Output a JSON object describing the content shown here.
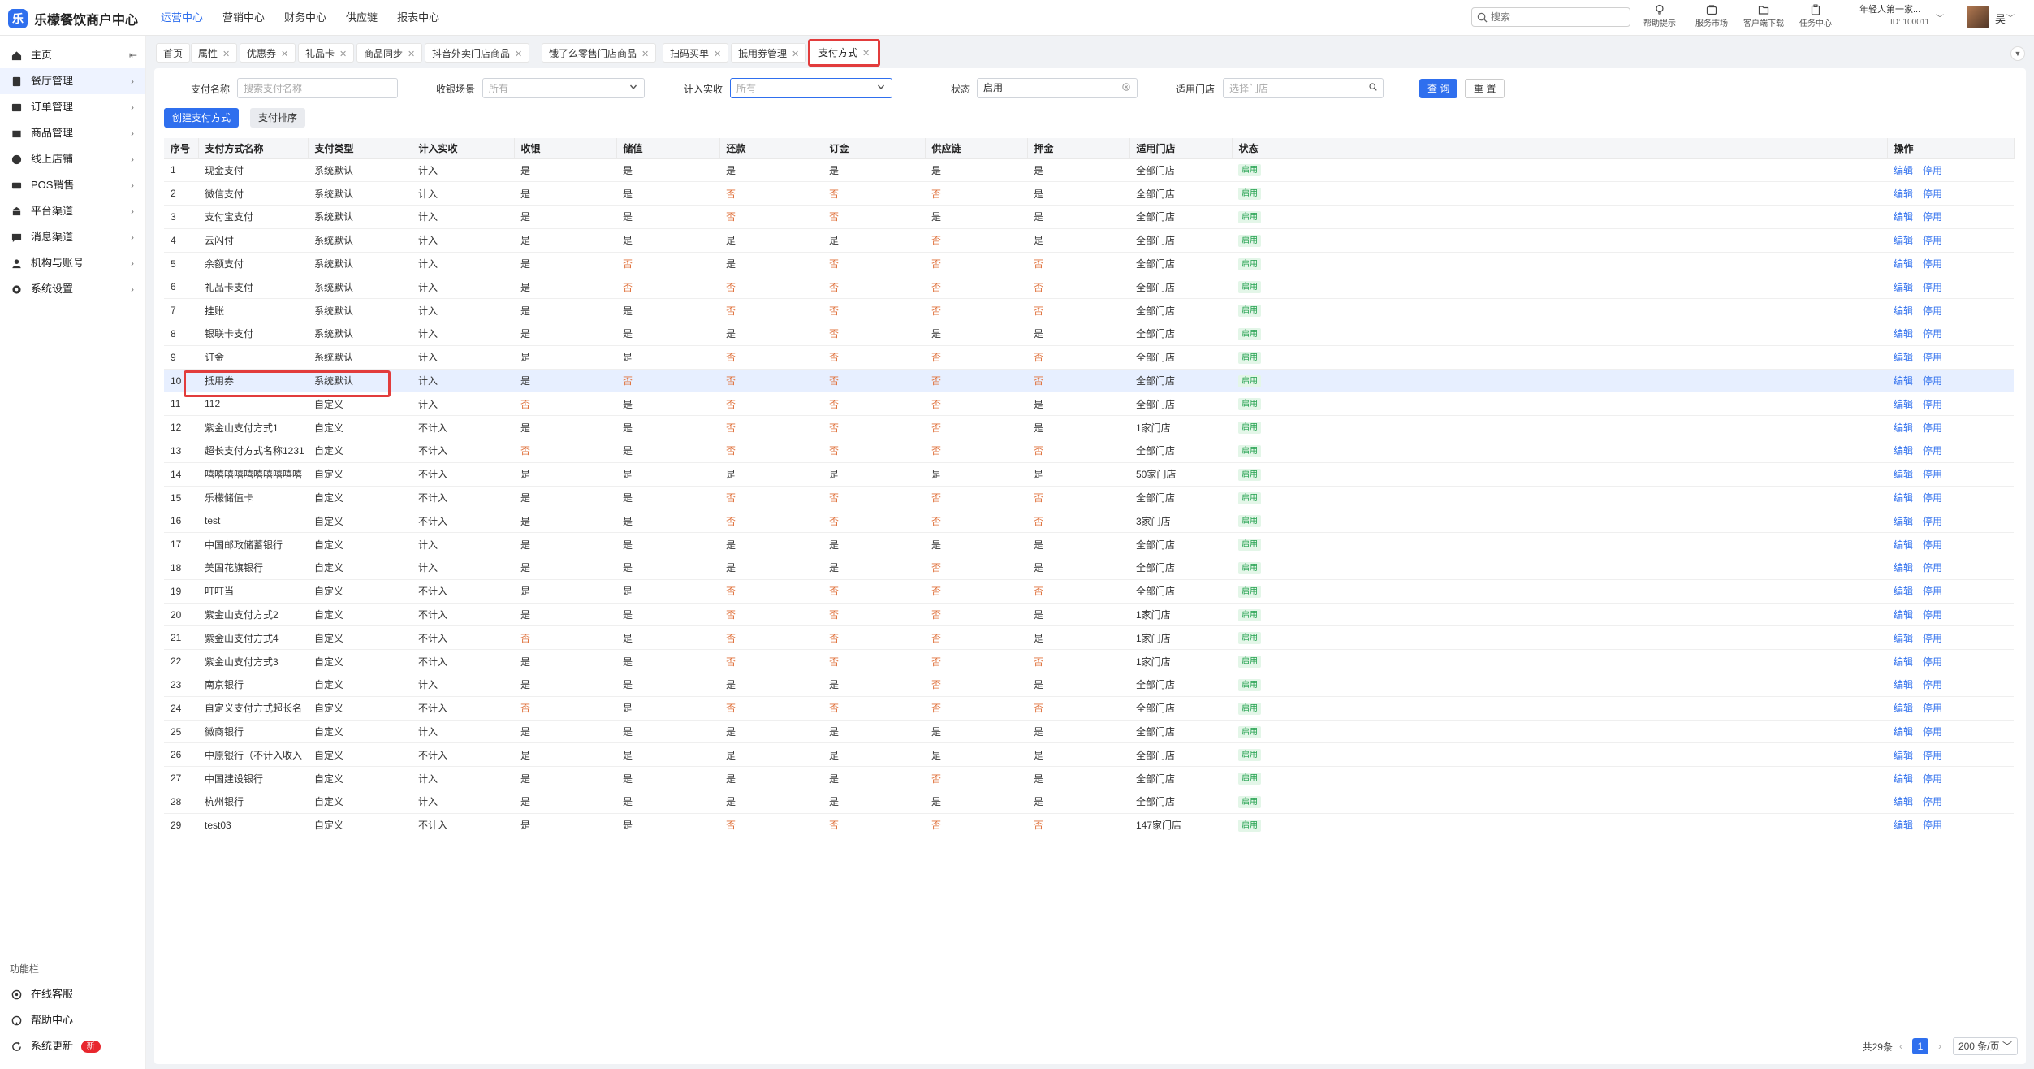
{
  "app": {
    "logo_mark": "乐",
    "title": "乐檬餐饮商户中心"
  },
  "topnav": [
    "运营中心",
    "营销中心",
    "财务中心",
    "供应链",
    "报表中心"
  ],
  "top_search": {
    "placeholder": "搜索"
  },
  "top_tools": [
    "帮助提示",
    "服务市场",
    "客户端下载",
    "任务中心"
  ],
  "org": {
    "name": "年轻人第一家...",
    "id": "ID: 100011"
  },
  "user": {
    "name": "吴"
  },
  "sidebar": {
    "items": [
      "主页",
      "餐厅管理",
      "订单管理",
      "商品管理",
      "线上店铺",
      "POS销售",
      "平台渠道",
      "消息渠道",
      "机构与账号",
      "系统设置"
    ],
    "func_title": "功能栏",
    "func_items": [
      "在线客服",
      "帮助中心",
      "系统更新"
    ],
    "new_badge": "新"
  },
  "tabs": [
    "首页",
    "属性",
    "优惠券",
    "礼品卡",
    "商品同步",
    "抖音外卖门店商品",
    "饿了么零售门店商品",
    "扫码买单",
    "抵用券管理",
    "支付方式"
  ],
  "filters": {
    "pay_name_label": "支付名称",
    "pay_name_placeholder": "搜索支付名称",
    "scene_label": "收银场景",
    "scene_placeholder": "所有",
    "income_label": "计入实收",
    "income_placeholder": "所有",
    "status_label": "状态",
    "status_value": "启用",
    "store_label": "适用门店",
    "store_placeholder": "选择门店",
    "query_btn": "查 询",
    "reset_btn": "重 置"
  },
  "actions": {
    "create_btn": "创建支付方式",
    "sort_btn": "支付排序"
  },
  "table": {
    "columns": [
      "序号",
      "支付方式名称",
      "支付类型",
      "计入实收",
      "收银",
      "储值",
      "还款",
      "订金",
      "供应链",
      "押金",
      "适用门店",
      "状态",
      "",
      "操作"
    ],
    "edit_label": "编辑",
    "disable_label": "停用",
    "rows": [
      [
        "1",
        "现金支付",
        "系统默认",
        "计入",
        "是",
        "是",
        "是",
        "是",
        "是",
        "是",
        "全部门店",
        "启用"
      ],
      [
        "2",
        "微信支付",
        "系统默认",
        "计入",
        "是",
        "是",
        "否",
        "否",
        "否",
        "是",
        "全部门店",
        "启用"
      ],
      [
        "3",
        "支付宝支付",
        "系统默认",
        "计入",
        "是",
        "是",
        "否",
        "否",
        "是",
        "是",
        "全部门店",
        "启用"
      ],
      [
        "4",
        "云闪付",
        "系统默认",
        "计入",
        "是",
        "是",
        "是",
        "是",
        "否",
        "是",
        "全部门店",
        "启用"
      ],
      [
        "5",
        "余额支付",
        "系统默认",
        "计入",
        "是",
        "否",
        "是",
        "否",
        "否",
        "否",
        "全部门店",
        "启用"
      ],
      [
        "6",
        "礼品卡支付",
        "系统默认",
        "计入",
        "是",
        "否",
        "否",
        "否",
        "否",
        "否",
        "全部门店",
        "启用"
      ],
      [
        "7",
        "挂账",
        "系统默认",
        "计入",
        "是",
        "是",
        "否",
        "否",
        "否",
        "否",
        "全部门店",
        "启用"
      ],
      [
        "8",
        "银联卡支付",
        "系统默认",
        "计入",
        "是",
        "是",
        "是",
        "否",
        "是",
        "是",
        "全部门店",
        "启用"
      ],
      [
        "9",
        "订金",
        "系统默认",
        "计入",
        "是",
        "是",
        "否",
        "否",
        "否",
        "否",
        "全部门店",
        "启用"
      ],
      [
        "10",
        "抵用券",
        "系统默认",
        "计入",
        "是",
        "否",
        "否",
        "否",
        "否",
        "否",
        "全部门店",
        "启用"
      ],
      [
        "11",
        "112",
        "自定义",
        "计入",
        "否",
        "是",
        "否",
        "否",
        "否",
        "是",
        "全部门店",
        "启用"
      ],
      [
        "12",
        "紫金山支付方式1",
        "自定义",
        "不计入",
        "是",
        "是",
        "否",
        "否",
        "否",
        "是",
        "1家门店",
        "启用"
      ],
      [
        "13",
        "超长支付方式名称1231",
        "自定义",
        "不计入",
        "否",
        "是",
        "否",
        "否",
        "否",
        "否",
        "全部门店",
        "启用"
      ],
      [
        "14",
        "嘻嘻嘻嘻嘻嘻嘻嘻嘻嘻",
        "自定义",
        "不计入",
        "是",
        "是",
        "是",
        "是",
        "是",
        "是",
        "50家门店",
        "启用"
      ],
      [
        "15",
        "乐檬储值卡",
        "自定义",
        "不计入",
        "是",
        "是",
        "否",
        "否",
        "否",
        "否",
        "全部门店",
        "启用"
      ],
      [
        "16",
        "test",
        "自定义",
        "不计入",
        "是",
        "是",
        "否",
        "否",
        "否",
        "否",
        "3家门店",
        "启用"
      ],
      [
        "17",
        "中国邮政储蓄银行",
        "自定义",
        "计入",
        "是",
        "是",
        "是",
        "是",
        "是",
        "是",
        "全部门店",
        "启用"
      ],
      [
        "18",
        "美国花旗银行",
        "自定义",
        "计入",
        "是",
        "是",
        "是",
        "是",
        "否",
        "是",
        "全部门店",
        "启用"
      ],
      [
        "19",
        "叮叮当",
        "自定义",
        "不计入",
        "是",
        "是",
        "否",
        "否",
        "否",
        "否",
        "全部门店",
        "启用"
      ],
      [
        "20",
        "紫金山支付方式2",
        "自定义",
        "不计入",
        "是",
        "是",
        "否",
        "否",
        "否",
        "是",
        "1家门店",
        "启用"
      ],
      [
        "21",
        "紫金山支付方式4",
        "自定义",
        "不计入",
        "否",
        "是",
        "否",
        "否",
        "否",
        "是",
        "1家门店",
        "启用"
      ],
      [
        "22",
        "紫金山支付方式3",
        "自定义",
        "不计入",
        "是",
        "是",
        "否",
        "否",
        "否",
        "否",
        "1家门店",
        "启用"
      ],
      [
        "23",
        "南京银行",
        "自定义",
        "计入",
        "是",
        "是",
        "是",
        "是",
        "否",
        "是",
        "全部门店",
        "启用"
      ],
      [
        "24",
        "自定义支付方式超长名",
        "自定义",
        "不计入",
        "否",
        "是",
        "否",
        "否",
        "否",
        "否",
        "全部门店",
        "启用"
      ],
      [
        "25",
        "徽商银行",
        "自定义",
        "计入",
        "是",
        "是",
        "是",
        "是",
        "是",
        "是",
        "全部门店",
        "启用"
      ],
      [
        "26",
        "中原银行（不计入收入",
        "自定义",
        "不计入",
        "是",
        "是",
        "是",
        "是",
        "是",
        "是",
        "全部门店",
        "启用"
      ],
      [
        "27",
        "中国建设银行",
        "自定义",
        "计入",
        "是",
        "是",
        "是",
        "是",
        "否",
        "是",
        "全部门店",
        "启用"
      ],
      [
        "28",
        "杭州银行",
        "自定义",
        "计入",
        "是",
        "是",
        "是",
        "是",
        "是",
        "是",
        "全部门店",
        "启用"
      ],
      [
        "29",
        "test03",
        "自定义",
        "不计入",
        "是",
        "是",
        "否",
        "否",
        "否",
        "否",
        "147家门店",
        "启用"
      ]
    ]
  },
  "pagination": {
    "total": "共29条",
    "current": "1",
    "page_size": "200 条/页"
  }
}
